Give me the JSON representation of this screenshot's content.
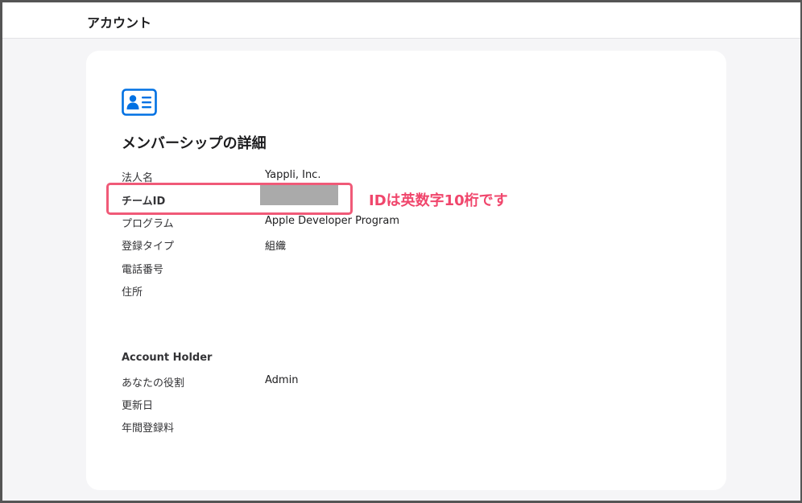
{
  "header": {
    "title": "アカウント"
  },
  "membership": {
    "icon": "contact-card-icon",
    "title": "メンバーシップの詳細",
    "rows": [
      {
        "label": "法人名",
        "value": "Yappli, Inc."
      },
      {
        "label": "チームID",
        "value": ""
      },
      {
        "label": "プログラム",
        "value": "Apple Developer Program"
      },
      {
        "label": "登録タイプ",
        "value": "組織"
      },
      {
        "label": "電話番号",
        "value": ""
      },
      {
        "label": "住所",
        "value": ""
      }
    ]
  },
  "account_holder": {
    "heading": "Account Holder",
    "rows": [
      {
        "label": "あなたの役割",
        "value": "Admin"
      },
      {
        "label": "更新日",
        "value": ""
      },
      {
        "label": "年間登録料",
        "value": ""
      }
    ]
  },
  "annotation": {
    "callout_text": "IDは英数字10桁です",
    "color": "#f0466c"
  },
  "colors": {
    "accent": "#0071e3",
    "background": "#f5f5f7",
    "card": "#ffffff",
    "redaction": "#aaaaaa"
  }
}
